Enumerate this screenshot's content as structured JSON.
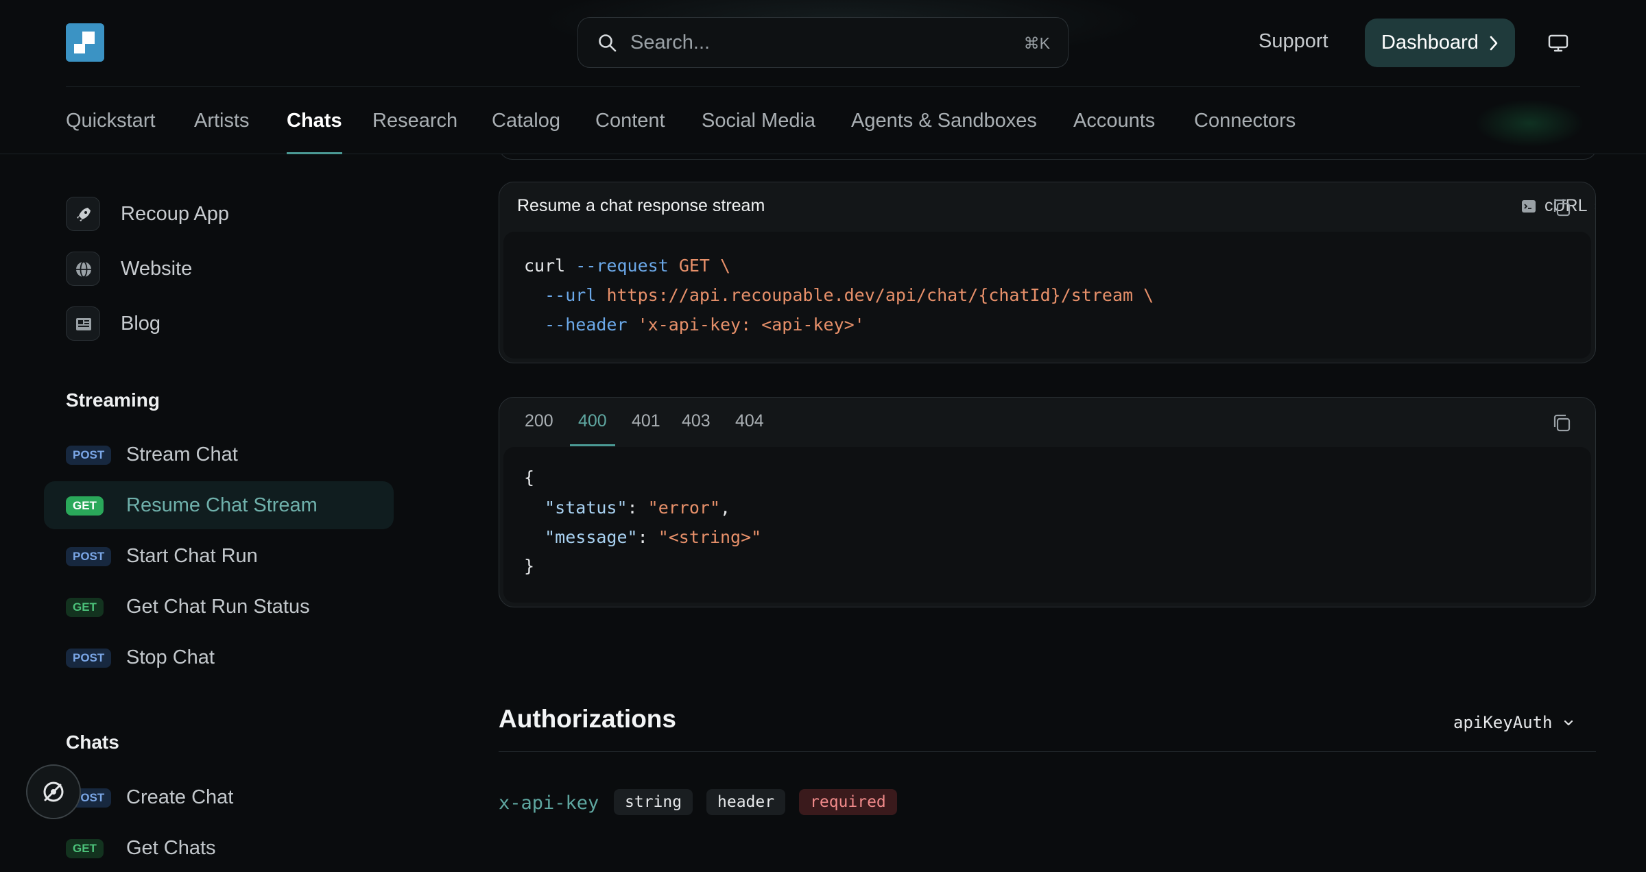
{
  "header": {
    "search": {
      "placeholder": "Search...",
      "shortcut": "⌘K"
    },
    "support_label": "Support",
    "dashboard_label": "Dashboard",
    "nav_tabs": [
      {
        "label": "Quickstart",
        "active": false
      },
      {
        "label": "Artists",
        "active": false
      },
      {
        "label": "Chats",
        "active": true
      },
      {
        "label": "Research",
        "active": false
      },
      {
        "label": "Catalog",
        "active": false
      },
      {
        "label": "Content",
        "active": false
      },
      {
        "label": "Social Media",
        "active": false
      },
      {
        "label": "Agents & Sandboxes",
        "active": false
      },
      {
        "label": "Accounts",
        "active": false
      },
      {
        "label": "Connectors",
        "active": false
      }
    ]
  },
  "sidebar": {
    "links": [
      {
        "label": "Recoup App",
        "icon": "rocket-icon"
      },
      {
        "label": "Website",
        "icon": "globe-icon"
      },
      {
        "label": "Blog",
        "icon": "newspaper-icon"
      }
    ],
    "groups": [
      {
        "title": "Streaming",
        "items": [
          {
            "method": "POST",
            "label": "Stream Chat",
            "active": false
          },
          {
            "method": "GET",
            "label": "Resume Chat Stream",
            "active": true
          },
          {
            "method": "POST",
            "label": "Start Chat Run",
            "active": false
          },
          {
            "method": "GET",
            "label": "Get Chat Run Status",
            "active": false
          },
          {
            "method": "POST",
            "label": "Stop Chat",
            "active": false
          }
        ]
      },
      {
        "title": "Chats",
        "items": [
          {
            "method": "POST",
            "label": "Create Chat",
            "active": false
          },
          {
            "method": "GET",
            "label": "Get Chats",
            "active": false
          }
        ]
      }
    ]
  },
  "request_card": {
    "title": "Resume a chat response stream",
    "language": "cURL",
    "code": {
      "l1_cmd": "curl",
      "l1_flag": "--request",
      "l1_method": "GET",
      "l1_cont": "\\",
      "l2_flag": "--url",
      "l2_url": "https://api.recoupable.dev/api/chat/{chatId}/stream",
      "l2_cont": "\\",
      "l3_flag": "--header",
      "l3_value": "'x-api-key: <api-key>'"
    }
  },
  "response_card": {
    "tabs": [
      {
        "label": "200",
        "active": false
      },
      {
        "label": "400",
        "active": true
      },
      {
        "label": "401",
        "active": false
      },
      {
        "label": "403",
        "active": false
      },
      {
        "label": "404",
        "active": false
      }
    ],
    "code": {
      "open": "{",
      "k1": "\"status\"",
      "v1": "\"error\"",
      "k2": "\"message\"",
      "v2": "\"<string>\"",
      "close": "}"
    }
  },
  "authorizations": {
    "title": "Authorizations",
    "selected_scheme": "apiKeyAuth",
    "param": {
      "name": "x-api-key",
      "type": "string",
      "location": "header",
      "required_label": "required"
    }
  },
  "colors": {
    "accent": "#4b9a95",
    "post_badge": "#7aa6e6",
    "get_badge": "#4cc27a",
    "string_literal": "#e7906a"
  }
}
